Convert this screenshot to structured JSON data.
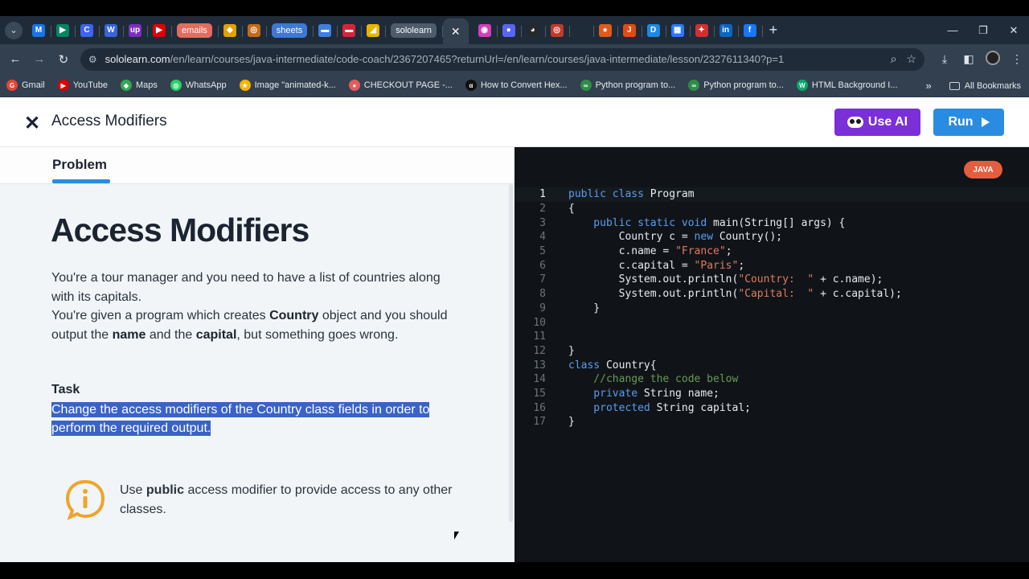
{
  "browser": {
    "tabs": [
      {
        "name": "tab-gmail",
        "icon": "M",
        "color": "#1a73e8"
      },
      {
        "name": "tab-play",
        "icon": "▶",
        "color": "#01875f"
      },
      {
        "name": "tab-c",
        "icon": "C",
        "color": "#3c64f0"
      },
      {
        "name": "tab-w",
        "icon": "W",
        "color": "#3866d6"
      },
      {
        "name": "tab-up",
        "icon": "up",
        "color": "#7a2ec4"
      },
      {
        "name": "tab-youtube",
        "icon": "▶",
        "color": "#e00000"
      },
      {
        "name": "tab-emails",
        "chip": "emails",
        "color": "#e76a5e"
      },
      {
        "name": "tab-pin",
        "icon": "◆",
        "color": "#e2a100"
      },
      {
        "name": "tab-o",
        "icon": "◎",
        "color": "#c46a17"
      },
      {
        "name": "tab-sheets",
        "chip": "sheets",
        "color": "#3c78d8"
      },
      {
        "name": "tab-doc",
        "icon": "▬",
        "color": "#3f7fe0"
      },
      {
        "name": "tab-red",
        "icon": "▬",
        "color": "#d5243a"
      },
      {
        "name": "tab-drive",
        "icon": "◢",
        "color": "#e8b400"
      },
      {
        "name": "tab-sololearn",
        "chip": "sololearn",
        "color": "#4d5b6a"
      }
    ],
    "tabs_after": [
      {
        "name": "tab-spinner",
        "icon": "◉",
        "color": "#d13fbd"
      },
      {
        "name": "tab-ring",
        "icon": "●",
        "color": "#5865f2"
      },
      {
        "name": "tab-github",
        "icon": "◕",
        "color": "#24292e"
      },
      {
        "name": "tab-target",
        "icon": "◎",
        "color": "#c0392b"
      },
      {
        "name": "tab-blank",
        "icon": "",
        "color": "#1f2b38"
      },
      {
        "name": "tab-orange",
        "icon": "●",
        "color": "#e05a1c"
      },
      {
        "name": "tab-j",
        "icon": "J",
        "color": "#e04b14"
      },
      {
        "name": "tab-d",
        "icon": "D",
        "color": "#1e88e5"
      },
      {
        "name": "tab-calendar",
        "icon": "▦",
        "color": "#2979ff"
      },
      {
        "name": "tab-flame",
        "icon": "✦",
        "color": "#d32f2f"
      },
      {
        "name": "tab-in",
        "icon": "in",
        "color": "#0a66c2"
      },
      {
        "name": "tab-facebook",
        "icon": "f",
        "color": "#1877f2"
      }
    ],
    "url_host": "sololearn.com",
    "url_path": "/en/learn/courses/java-intermediate/code-coach/2367207465?returnUrl=/en/learn/courses/java-intermediate/lesson/2327611340?p=1",
    "bookmarks": [
      {
        "label": "Gmail",
        "icon": "G",
        "color": "#ea4335"
      },
      {
        "label": "YouTube",
        "icon": "▶",
        "color": "#e00000"
      },
      {
        "label": "Maps",
        "icon": "◆",
        "color": "#34a853"
      },
      {
        "label": "WhatsApp",
        "icon": "◎",
        "color": "#25d366"
      },
      {
        "label": "Image \"animated-k...",
        "icon": "★",
        "color": "#f4b400"
      },
      {
        "label": "CHECKOUT PAGE -...",
        "icon": "●",
        "color": "#e55b5b"
      },
      {
        "label": "How to Convert Hex...",
        "icon": "α",
        "color": "#111111"
      },
      {
        "label": "Python program to...",
        "icon": "∞",
        "color": "#2f8d46"
      },
      {
        "label": "Python program to...",
        "icon": "∞",
        "color": "#2f8d46"
      },
      {
        "label": "HTML Background I...",
        "icon": "W",
        "color": "#04aa6d"
      }
    ],
    "all_bookmarks": "All Bookmarks"
  },
  "header": {
    "title": "Access Modifiers",
    "use_ai": "Use AI",
    "run": "Run"
  },
  "problem": {
    "tab_label": "Problem",
    "heading": "Access Modifiers",
    "p1": "You're a tour manager and you need to have a list of countries along with its capitals.",
    "p2a": "You're given a program which creates ",
    "p2b": "Country",
    "p2c": " object and you should output the ",
    "p2d": "name",
    "p2e": " and the ",
    "p2f": "capital",
    "p2g": ", but something goes wrong.",
    "task_label": "Task",
    "task_text": "Change the access modifiers of the Country class fields in order to perform the required output.",
    "tip_a": "Use ",
    "tip_b": "public",
    "tip_c": " access modifier to provide access to any other classes."
  },
  "editor": {
    "language": "JAVA",
    "lines": [
      [
        {
          "t": "public class ",
          "c": "kw"
        },
        {
          "t": "Program",
          "c": ""
        }
      ],
      [
        {
          "t": "{",
          "c": ""
        }
      ],
      [
        {
          "t": "    public static void ",
          "c": "kw"
        },
        {
          "t": "main(String[] args) {",
          "c": ""
        }
      ],
      [
        {
          "t": "        Country c = ",
          "c": ""
        },
        {
          "t": "new ",
          "c": "kw"
        },
        {
          "t": "Country();",
          "c": ""
        }
      ],
      [
        {
          "t": "        c.name = ",
          "c": ""
        },
        {
          "t": "\"France\"",
          "c": "str"
        },
        {
          "t": ";",
          "c": ""
        }
      ],
      [
        {
          "t": "        c.capital = ",
          "c": ""
        },
        {
          "t": "\"Paris\"",
          "c": "str"
        },
        {
          "t": ";",
          "c": ""
        }
      ],
      [
        {
          "t": "        System.out.println(",
          "c": ""
        },
        {
          "t": "\"Country:  \"",
          "c": "str"
        },
        {
          "t": " + c.name);",
          "c": ""
        }
      ],
      [
        {
          "t": "        System.out.println(",
          "c": ""
        },
        {
          "t": "\"Capital:  \"",
          "c": "str"
        },
        {
          "t": " + c.capital);",
          "c": ""
        }
      ],
      [
        {
          "t": "    }",
          "c": ""
        }
      ],
      [],
      [],
      [
        {
          "t": "}",
          "c": ""
        }
      ],
      [
        {
          "t": "class ",
          "c": "kw"
        },
        {
          "t": "Country{",
          "c": ""
        }
      ],
      [
        {
          "t": "    //change the code below",
          "c": "cm"
        }
      ],
      [
        {
          "t": "    private ",
          "c": "kw"
        },
        {
          "t": "String name;",
          "c": ""
        }
      ],
      [
        {
          "t": "    protected ",
          "c": "kw"
        },
        {
          "t": "String capital;",
          "c": ""
        }
      ],
      [
        {
          "t": "}",
          "c": ""
        }
      ]
    ]
  },
  "colors": {
    "accent_blue": "#2a8ce0",
    "ai_purple": "#7b2fd8",
    "java_badge": "#e45d3f",
    "highlight": "#3a62c8"
  }
}
